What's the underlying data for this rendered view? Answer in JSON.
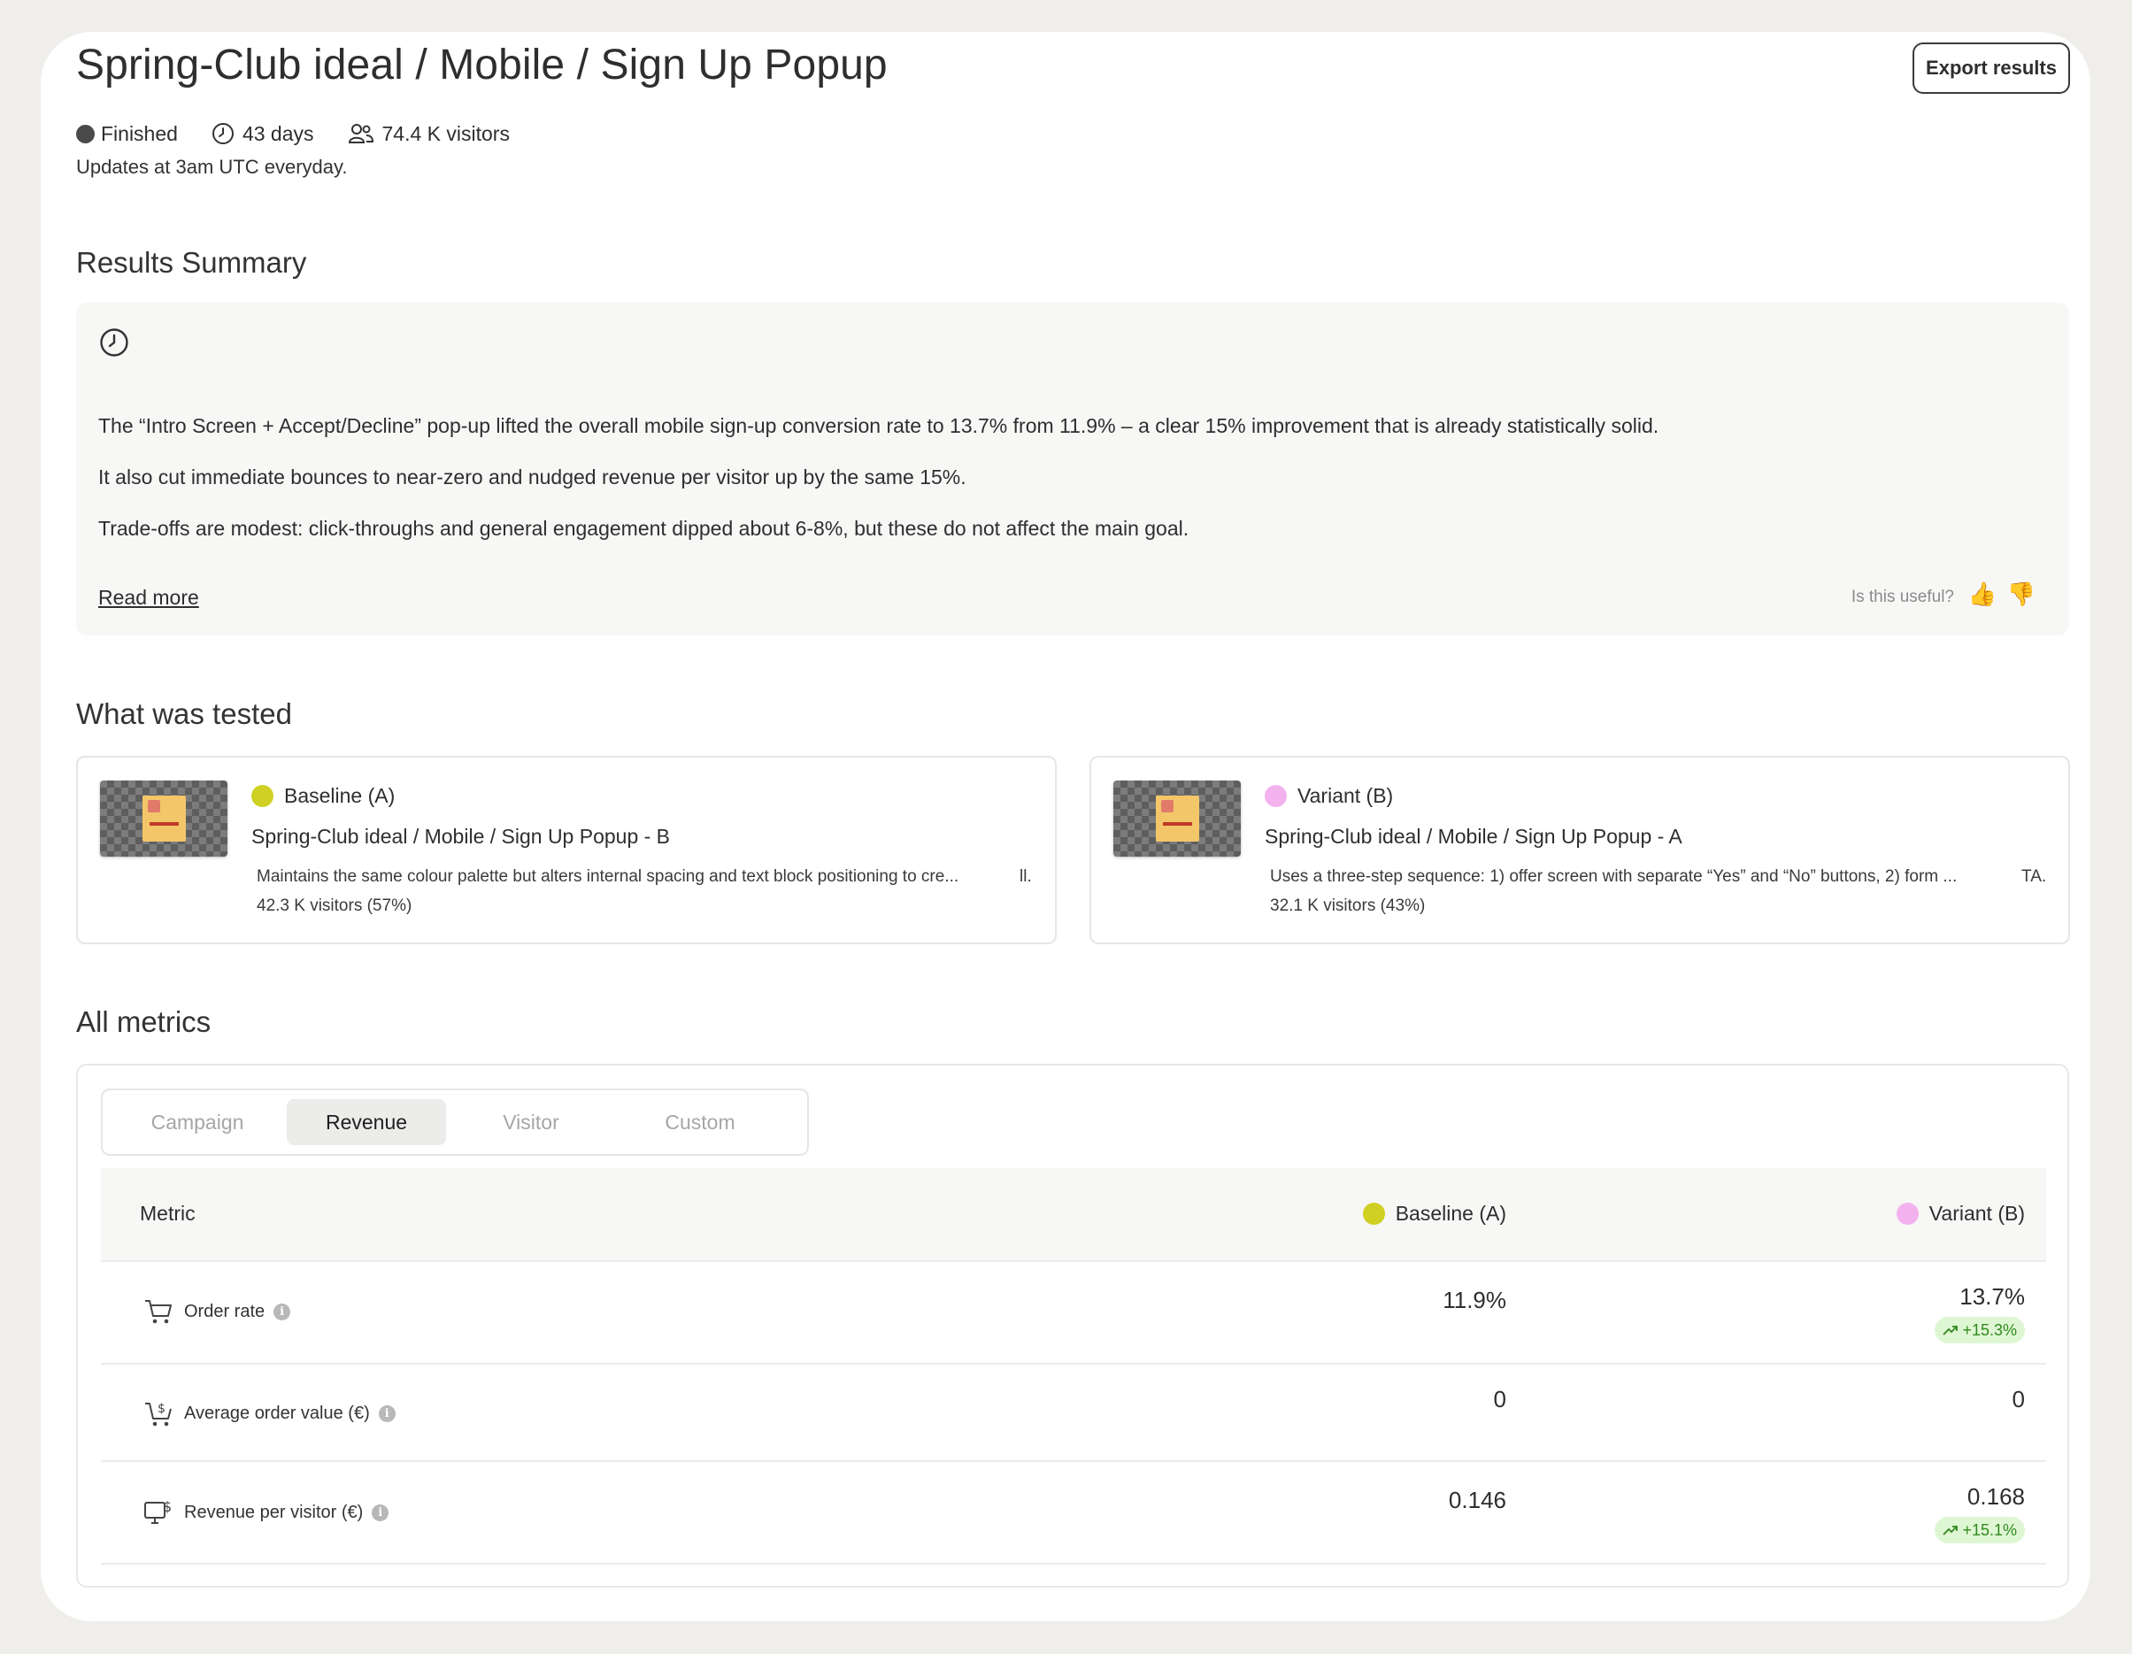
{
  "header": {
    "title": "Spring-Club ideal / Mobile / Sign Up Popup",
    "export_label": "Export results",
    "status": "Finished",
    "duration": "43 days",
    "visitors": "74.4 K visitors",
    "updates_note": "Updates at 3am UTC everyday."
  },
  "summary": {
    "heading": "Results Summary",
    "paragraphs": [
      "The “Intro Screen + Accept/Decline” pop-up lifted the overall mobile sign-up conversion rate to 13.7% from 11.9% – a clear 15% improvement that is already statistically solid.",
      "It also cut immediate bounces to near-zero and nudged revenue per visitor up by the same 15%.",
      "Trade-offs are modest: click-throughs and general engagement dipped about 6-8%, but these do not affect the main goal."
    ],
    "read_more": "Read more",
    "useful_prompt": "Is this useful?",
    "thumbs_up": "👍",
    "thumbs_down": "👎"
  },
  "tested": {
    "heading": "What was tested",
    "variants": [
      {
        "label": "Baseline (A)",
        "color": "#cfd023",
        "name": "Spring-Club ideal / Mobile / Sign Up Popup - B",
        "description": "Maintains the same colour palette but alters internal spacing and text block positioning to cre...",
        "description_tail": "ll.",
        "visitors": "42.3 K visitors (57%)"
      },
      {
        "label": "Variant (B)",
        "color": "#f3b2ee",
        "name": "Spring-Club ideal / Mobile / Sign Up Popup - A",
        "description": "Uses a three-step sequence: 1) offer screen with separate “Yes” and “No” buttons, 2) form ...",
        "description_tail": "TA.",
        "visitors": "32.1 K visitors (43%)"
      }
    ]
  },
  "metrics": {
    "heading": "All metrics",
    "tabs": [
      "Campaign",
      "Revenue",
      "Visitor",
      "Custom"
    ],
    "active_tab": "Revenue",
    "columns": {
      "metric": "Metric",
      "baseline": "Baseline (A)",
      "variant": "Variant (B)"
    },
    "rows": [
      {
        "name": "Order rate",
        "icon": "cart-icon",
        "baseline": "11.9%",
        "variant": "13.7%",
        "change": "+15.3%"
      },
      {
        "name": "Average order value (€)",
        "icon": "cart-dollar-icon",
        "baseline": "0",
        "variant": "0",
        "change": ""
      },
      {
        "name": "Revenue per visitor (€)",
        "icon": "monitor-dollar-icon",
        "baseline": "0.146",
        "variant": "0.168",
        "change": "+15.1%"
      }
    ],
    "info_glyph": "i"
  }
}
